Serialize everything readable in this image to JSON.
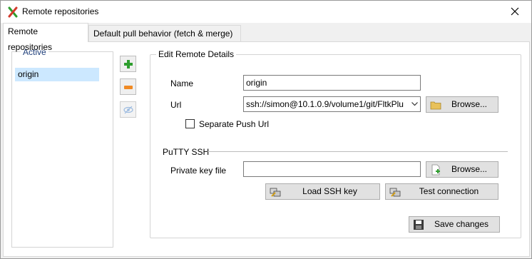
{
  "window": {
    "title": "Remote repositories"
  },
  "tabs": [
    {
      "label": "Remote repositories",
      "active": true
    },
    {
      "label": "Default pull behavior (fetch & merge)",
      "active": false
    }
  ],
  "active_group": {
    "legend": "Active",
    "items": [
      "origin"
    ]
  },
  "edit": {
    "legend": "Edit Remote Details",
    "name_label": "Name",
    "name_value": "origin",
    "url_label": "Url",
    "url_value": "ssh://simon@10.1.0.9/volume1/git/FltkPlu",
    "browse_url_label": "Browse...",
    "separate_push_label": "Separate Push Url",
    "separate_push_checked": false
  },
  "putty": {
    "legend": "PuTTY SSH",
    "key_label": "Private key file",
    "key_value": "",
    "browse_key_label": "Browse...",
    "load_key_label": "Load SSH key",
    "test_label": "Test connection"
  },
  "save_label": "Save changes",
  "colors": {
    "selection": "#cce8ff",
    "legend_blue": "#1f3f7a",
    "add_green": "#2e9e2e",
    "remove_orange": "#f08a24"
  }
}
